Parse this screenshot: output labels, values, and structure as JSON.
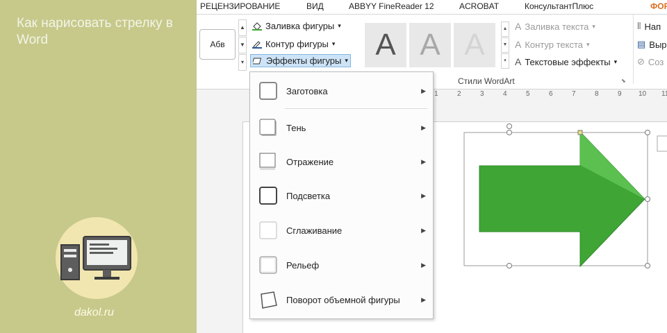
{
  "left_panel": {
    "title": "Как нарисовать стрелку в Word",
    "site": "dakol.ru"
  },
  "tabs": [
    "РЕЦЕНЗИРОВАНИЕ",
    "ВИД",
    "ABBYY FineReader 12",
    "ACROBAT",
    "КонсультантПлюс",
    "ФОР"
  ],
  "ribbon": {
    "style_preview": "Абв",
    "commands": {
      "fill": "Заливка фигуры",
      "outline": "Контур фигуры",
      "effects": "Эффекты фигуры"
    },
    "wordart_letters": [
      "A",
      "A",
      "A"
    ],
    "text_commands": {
      "text_fill": "Заливка текста",
      "text_outline": "Контур текста",
      "text_effects": "Текстовые эффекты"
    },
    "cut_cmds": [
      "Нап",
      "Выр",
      "Соз"
    ],
    "group_label": "Стили WordArt"
  },
  "ruler": [
    "1",
    "2",
    "3",
    "4",
    "5",
    "6",
    "7",
    "8",
    "9",
    "10",
    "11"
  ],
  "menu": {
    "items": [
      {
        "label": "Заготовка"
      },
      {
        "label": "Тень"
      },
      {
        "label": "Отражение"
      },
      {
        "label": "Подсветка"
      },
      {
        "label": "Сглаживание"
      },
      {
        "label": "Рельеф"
      },
      {
        "label": "Поворот объемной фигуры"
      }
    ]
  },
  "colors": {
    "left_bg": "#c6c98a",
    "arrow_green": "#3fa535",
    "accent_orange": "#d96f1f"
  }
}
